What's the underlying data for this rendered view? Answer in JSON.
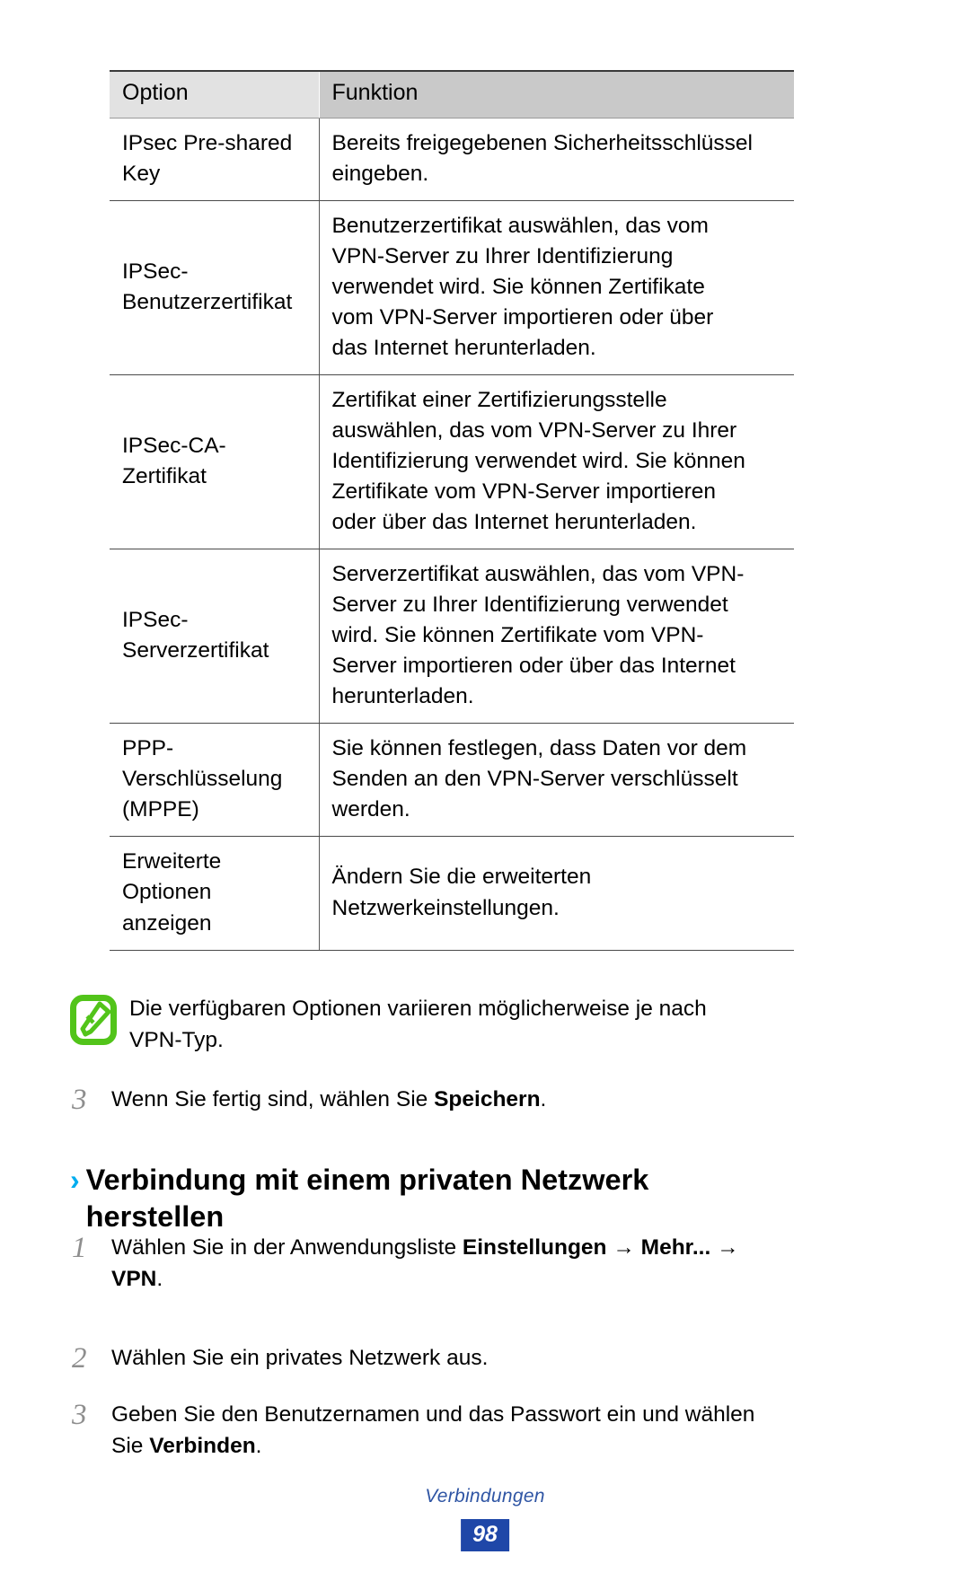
{
  "table": {
    "headers": [
      "Option",
      "Funktion"
    ],
    "rows": [
      {
        "option_lines": [
          "IPsec Pre-shared",
          "Key"
        ],
        "function_lines": [
          "Bereits freigegebenen Sicherheitsschlüssel",
          "eingeben."
        ]
      },
      {
        "option_lines": [
          "IPSec-",
          "Benutzerzertifikat"
        ],
        "function_lines": [
          "Benutzerzertifikat auswählen, das vom",
          "VPN-Server zu Ihrer Identifizierung",
          "verwendet wird. Sie können Zertifikate",
          "vom VPN-Server importieren oder über",
          "das Internet herunterladen."
        ]
      },
      {
        "option_lines": [
          "IPSec-CA-",
          "Zertifikat"
        ],
        "function_lines": [
          "Zertifikat einer Zertifizierungsstelle",
          "auswählen, das vom VPN-Server zu Ihrer",
          "Identifizierung verwendet wird. Sie können",
          "Zertifikate vom VPN-Server importieren",
          "oder über das Internet herunterladen."
        ]
      },
      {
        "option_lines": [
          "IPSec-",
          "Serverzertifikat"
        ],
        "function_lines": [
          "Serverzertifikat auswählen, das vom VPN-",
          "Server zu Ihrer Identifizierung verwendet",
          "wird. Sie können Zertifikate vom VPN-",
          "Server importieren oder über das Internet",
          "herunterladen."
        ]
      },
      {
        "option_lines": [
          "PPP-",
          "Verschlüsselung",
          "(MPPE)"
        ],
        "function_lines": [
          "Sie können festlegen, dass Daten vor dem",
          "Senden an den VPN-Server verschlüsselt",
          "werden."
        ]
      },
      {
        "option_lines": [
          "Erweiterte",
          "Optionen",
          "anzeigen"
        ],
        "function_lines": [
          "Ändern Sie die erweiterten",
          "Netzwerkeinstellungen."
        ]
      }
    ]
  },
  "note": {
    "icon": "note-pencil-icon",
    "icon_color": "#52c41a",
    "lines": [
      "Die verfügbaren Optionen variieren möglicherweise je nach",
      "VPN-Typ."
    ]
  },
  "step_save": {
    "number": "3",
    "prefix": "Wenn Sie fertig sind, wählen Sie ",
    "bold": "Speichern",
    "suffix": "."
  },
  "heading": {
    "chevron": "›",
    "chevron_color": "#00adef",
    "lines": [
      "Verbindung mit einem privaten Netzwerk",
      "herstellen"
    ]
  },
  "connect_steps": [
    {
      "number": "1",
      "line1_prefix": "Wählen Sie in der Anwendungsliste ",
      "line1_bold1": "Einstellungen",
      "line1_arrow": " → ",
      "line1_bold2": "Mehr...",
      "line1_arrow2": " →",
      "line2_bold": "VPN",
      "line2_suffix": "."
    },
    {
      "number": "2",
      "text": "Wählen Sie ein privates Netzwerk aus."
    },
    {
      "number": "3",
      "line1": "Geben Sie den Benutzernamen und das Passwort ein und wählen",
      "line2_prefix": "Sie ",
      "line2_bold": "Verbinden",
      "line2_suffix": "."
    }
  ],
  "footer": {
    "label": "Verbindungen",
    "page_number": "98",
    "label_color": "#2f55a4",
    "page_badge_color": "#1f47a8"
  }
}
